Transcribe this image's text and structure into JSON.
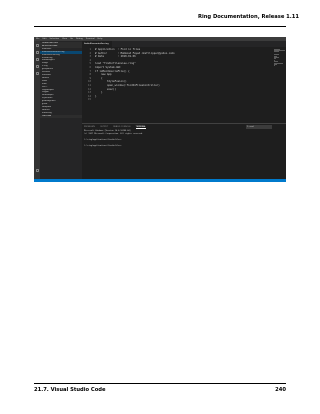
{
  "doc": {
    "header": "Ring Documentation, Release 1.11",
    "footer_left": "21.7. Visual Studio Code",
    "footer_right": "240"
  },
  "vscode": {
    "menu": [
      "File",
      "Edit",
      "Selection",
      "View",
      "Go",
      "Debug",
      "Terminal",
      "Help"
    ],
    "tab_label": "findinfilescontroller.ring",
    "sidebar": [
      {
        "label": "OPEN EDITORS",
        "kind": "hdr"
      },
      {
        "label": "APPLICATIONS",
        "kind": "hdr"
      },
      {
        "label": "findinfiles",
        "kind": "row"
      },
      {
        "label": "findinfilescontroller.ring",
        "kind": "sel"
      },
      {
        "label": "findinfilesview.ring",
        "kind": "row"
      },
      {
        "label": "fifview.ring",
        "kind": "row"
      },
      {
        "label": "formdesigner",
        "kind": "row"
      },
      {
        "label": "image",
        "kind": "row"
      },
      {
        "label": "3.ring",
        "kind": "row"
      },
      {
        "label": "getquarters",
        "kind": "row"
      },
      {
        "label": "iteration",
        "kind": "row"
      },
      {
        "label": "fontshow",
        "kind": "row"
      },
      {
        "label": "libtools",
        "kind": "row"
      },
      {
        "label": "ltools",
        "kind": "row"
      },
      {
        "label": "main",
        "kind": "row"
      },
      {
        "label": "PWCT",
        "kind": "row"
      },
      {
        "label": "ringnotepad",
        "kind": "row"
      },
      {
        "label": "ringpm",
        "kind": "row"
      },
      {
        "label": "smartlooper",
        "kind": "row"
      },
      {
        "label": "stylefusion",
        "kind": "row"
      },
      {
        "label": "goldmagic800",
        "kind": "row"
      },
      {
        "label": "guilib",
        "kind": "row"
      },
      {
        "label": "libdepwin",
        "kind": "row"
      },
      {
        "label": "libraries",
        "kind": "row"
      },
      {
        "label": "marketing",
        "kind": "row"
      },
      {
        "label": "OUTLINE",
        "kind": "hdr"
      }
    ],
    "code": [
      {
        "n": "1",
        "text": "# Application  : Find in files"
      },
      {
        "n": "2",
        "text": "# Author       : Mahmoud Fayed <msfclipper@yahoo.com>"
      },
      {
        "n": "3",
        "text": "# Date         : 2018.01.06"
      },
      {
        "n": "4",
        "text": ""
      },
      {
        "n": "5",
        "text": "load \"findinfilesview.ring\""
      },
      {
        "n": "6",
        "text": "import System.GUI"
      },
      {
        "n": "7",
        "text": "if isMainSourceFile() {"
      },
      {
        "n": "8",
        "text": "    new App"
      },
      {
        "n": "9",
        "text": "    {"
      },
      {
        "n": "10",
        "text": "        StyleFusion()"
      },
      {
        "n": "11",
        "text": "        open_window(:findInFilesController)"
      },
      {
        "n": "12",
        "text": "        exec()"
      },
      {
        "n": "13",
        "text": "    }"
      },
      {
        "n": "14",
        "text": "}"
      },
      {
        "n": "15",
        "text": ""
      }
    ],
    "panel_tabs": [
      "PROBLEMS",
      "OUTPUT",
      "DEBUG CONSOLE",
      "TERMINAL"
    ],
    "terminal_select": "1: cmd",
    "terminal": [
      "Microsoft Windows [Version 10.0.16299.64]",
      "(c) 2017 Microsoft Corporation. All rights reserved.",
      "",
      "C:\\ring\\applications\\findinfiles>",
      "",
      "C:\\ring\\applications\\findinfiles>"
    ]
  }
}
